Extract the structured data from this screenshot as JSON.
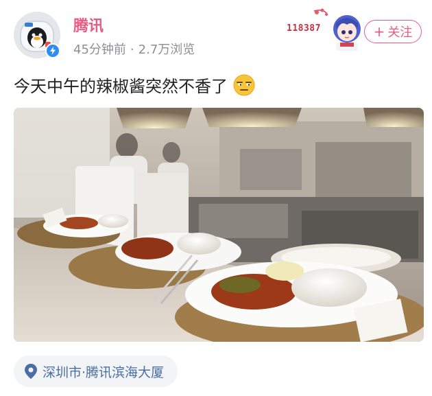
{
  "author": {
    "name": "腾讯",
    "time": "45分钟前",
    "views": "2.7万浏览",
    "separator": "·",
    "avatar_icon": "penguin-astronaut-avatar",
    "verified_icon": "lightning-badge-icon"
  },
  "decoration": {
    "number": "118387",
    "icon": "anime-character-sticker"
  },
  "follow_button": {
    "plus": "+",
    "label": "关注"
  },
  "post": {
    "text": "今天中午的辣椒酱突然不香了",
    "emoji": "unamused-face-emoji"
  },
  "photo": {
    "description_icon": "canteen-food-photo"
  },
  "location": {
    "icon": "map-pin-icon",
    "text": "深圳市·腾讯滨海大厦"
  },
  "colors": {
    "accent": "#ea5b84",
    "meta_text": "#8e8e93",
    "location_text": "#4a6fa5",
    "location_bg": "#f3f4f6",
    "verified_badge": "#2f8cf4"
  }
}
